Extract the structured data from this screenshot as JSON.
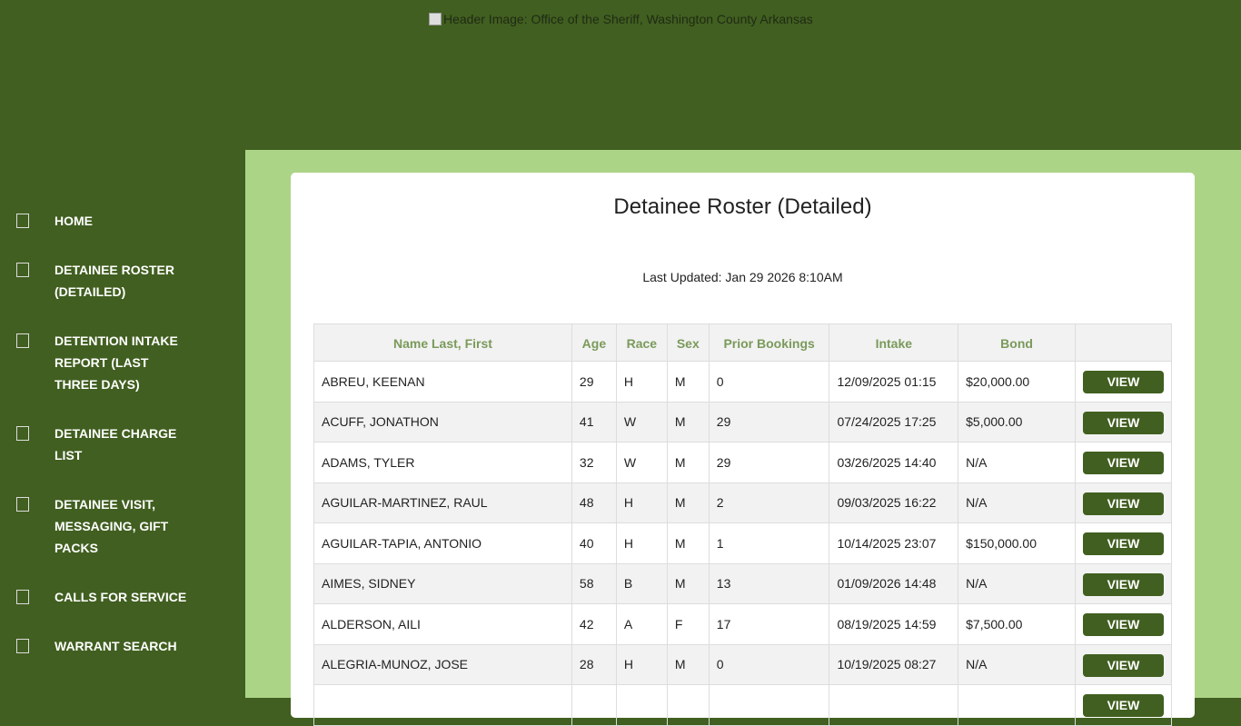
{
  "header": {
    "image_alt": "Header Image: Office of the Sheriff, Washington County Arkansas"
  },
  "sidebar": {
    "items": [
      {
        "label": "HOME"
      },
      {
        "label": "DETAINEE ROSTER (DETAILED)"
      },
      {
        "label": "DETENTION INTAKE REPORT (LAST THREE DAYS)"
      },
      {
        "label": "DETAINEE CHARGE LIST"
      },
      {
        "label": "DETAINEE VISIT, MESSAGING, GIFT PACKS"
      },
      {
        "label": "CALLS FOR SERVICE"
      },
      {
        "label": "WARRANT SEARCH"
      }
    ]
  },
  "page": {
    "title": "Detainee Roster (Detailed)",
    "updated": "Last Updated: Jan 29 2026 8:10AM"
  },
  "table": {
    "headers": [
      "Name Last, First",
      "Age",
      "Race",
      "Sex",
      "Prior Bookings",
      "Intake",
      "Bond",
      ""
    ],
    "view_label": "VIEW",
    "rows": [
      [
        "ABREU, KEENAN",
        "29",
        "H",
        "M",
        "0",
        "12/09/2025 01:15",
        "$20,000.00"
      ],
      [
        "ACUFF, JONATHON",
        "41",
        "W",
        "M",
        "29",
        "07/24/2025 17:25",
        "$5,000.00"
      ],
      [
        "ADAMS, TYLER",
        "32",
        "W",
        "M",
        "29",
        "03/26/2025 14:40",
        "N/A"
      ],
      [
        "AGUILAR-MARTINEZ, RAUL",
        "48",
        "H",
        "M",
        "2",
        "09/03/2025 16:22",
        "N/A"
      ],
      [
        "AGUILAR-TAPIA, ANTONIO",
        "40",
        "H",
        "M",
        "1",
        "10/14/2025 23:07",
        "$150,000.00"
      ],
      [
        "AIMES, SIDNEY",
        "58",
        "B",
        "M",
        "13",
        "01/09/2026 14:48",
        "N/A"
      ],
      [
        "ALDERSON, AILI",
        "42",
        "A",
        "F",
        "17",
        "08/19/2025 14:59",
        "$7,500.00"
      ],
      [
        "ALEGRIA-MUNOZ, JOSE",
        "28",
        "H",
        "M",
        "0",
        "10/19/2025 08:27",
        "N/A"
      ],
      [
        "",
        "",
        "",
        "",
        "",
        "",
        ""
      ]
    ]
  }
}
